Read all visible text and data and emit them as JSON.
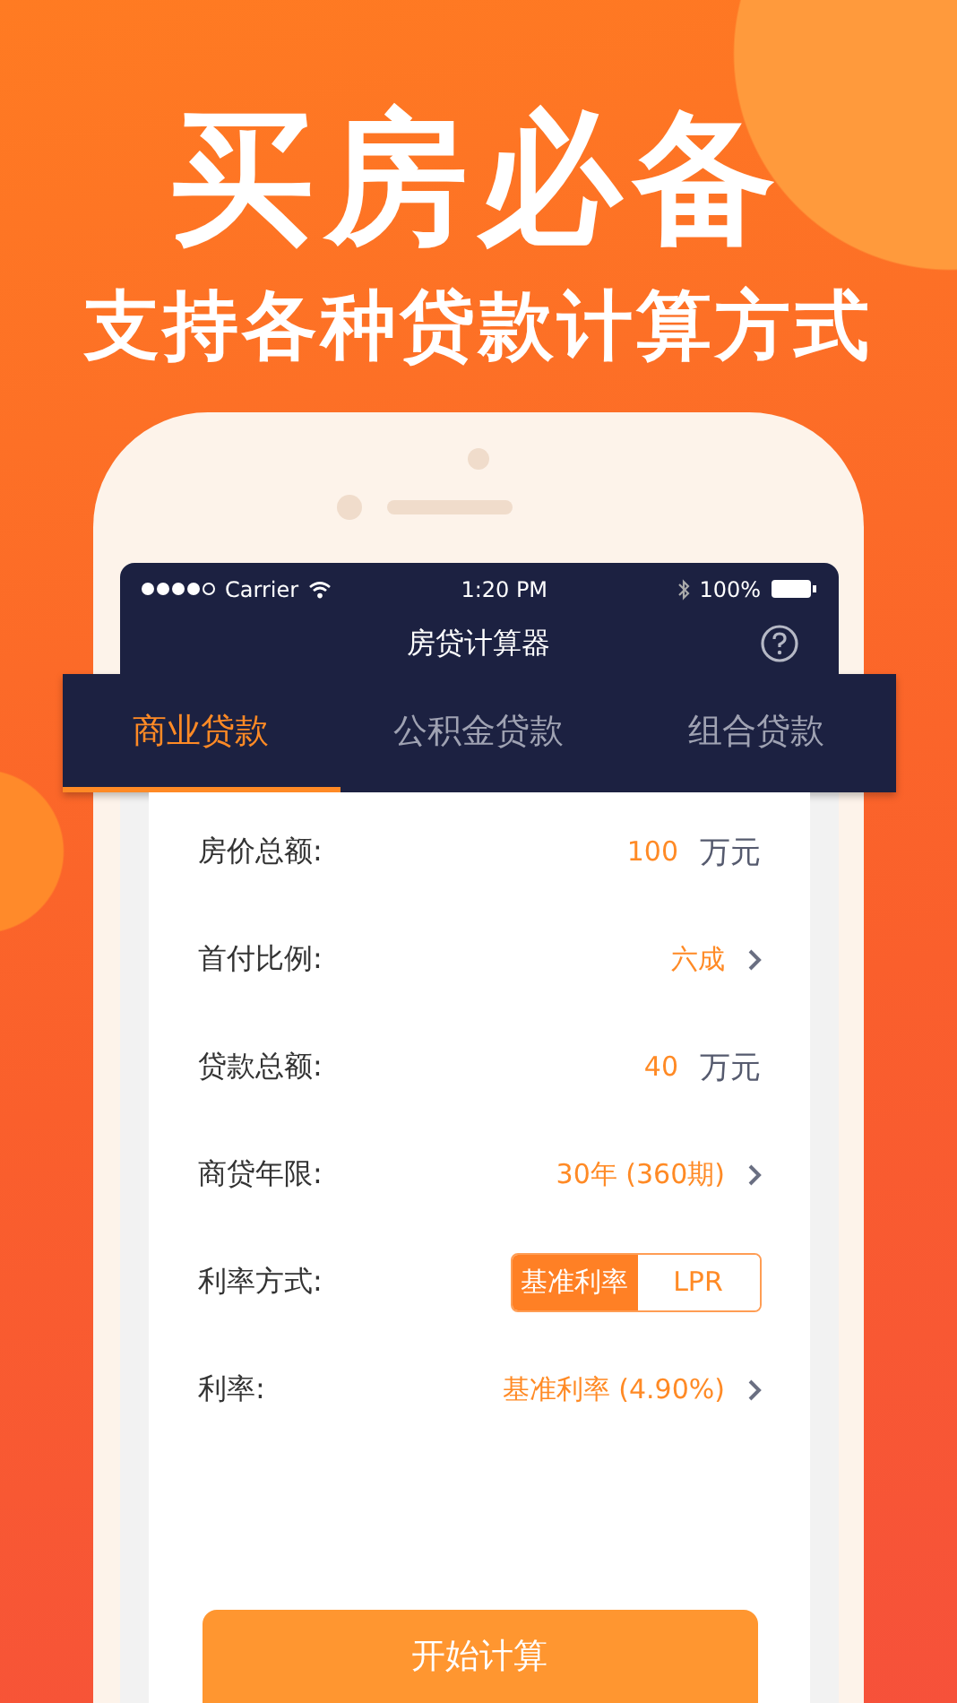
{
  "headline": "买房必备",
  "subheadline": "支持各种贷款计算方式",
  "status_bar": {
    "carrier": "Carrier",
    "time": "1:20 PM",
    "battery": "100%"
  },
  "nav": {
    "title": "房贷计算器"
  },
  "tabs": [
    {
      "label": "商业贷款",
      "selected": true
    },
    {
      "label": "公积金贷款",
      "selected": false
    },
    {
      "label": "组合贷款",
      "selected": false
    }
  ],
  "fields": [
    {
      "kind": "input",
      "label": "房价总额:",
      "value": "100",
      "unit": "万元"
    },
    {
      "kind": "select",
      "label": "首付比例:",
      "value": "六成"
    },
    {
      "kind": "input",
      "label": "贷款总额:",
      "value": "40",
      "unit": "万元"
    },
    {
      "kind": "select",
      "label": "商贷年限:",
      "value": "30年 (360期)"
    },
    {
      "kind": "toggle",
      "label": "利率方式:",
      "options": [
        {
          "label": "基准利率",
          "selected": true
        },
        {
          "label": "LPR",
          "selected": false
        }
      ]
    },
    {
      "kind": "select",
      "label": "利率:",
      "value": "基准利率 (4.90%)"
    }
  ],
  "button": "开始计算"
}
